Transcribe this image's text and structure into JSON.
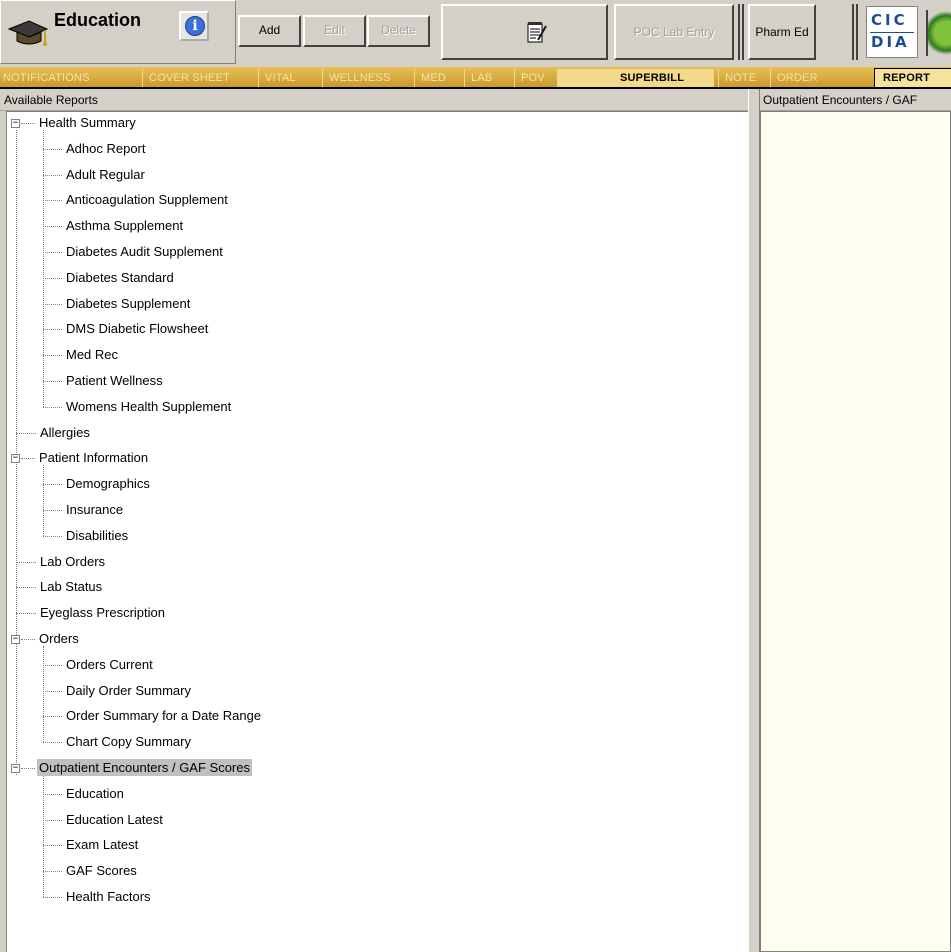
{
  "toolbar": {
    "title": "Education",
    "info_label": "i",
    "add_label": "Add",
    "edit_label": "Edit",
    "delete_label": "Delete",
    "poc_label": "POC Lab Entry",
    "pharm_label": "Pharm Ed",
    "cic_line1": "CIC",
    "cic_line2": "DIA"
  },
  "tabs": [
    {
      "label": "NOTIFICATIONS"
    },
    {
      "label": "COVER SHEET"
    },
    {
      "label": "VITAL"
    },
    {
      "label": "WELLNESS"
    },
    {
      "label": "MED"
    },
    {
      "label": "LAB"
    },
    {
      "label": "POV"
    },
    {
      "label": "SUPERBILL"
    },
    {
      "label": "NOTE"
    },
    {
      "label": "ORDER"
    },
    {
      "label": "REPORT"
    }
  ],
  "left_panel": {
    "header": "Available Reports",
    "tree": [
      {
        "label": "Health Summary",
        "expander": "−"
      },
      {
        "label": "Adhoc Report"
      },
      {
        "label": "Adult Regular"
      },
      {
        "label": "Anticoagulation Supplement"
      },
      {
        "label": "Asthma Supplement"
      },
      {
        "label": "Diabetes Audit Supplement"
      },
      {
        "label": "Diabetes Standard"
      },
      {
        "label": "Diabetes Supplement"
      },
      {
        "label": "DMS Diabetic Flowsheet"
      },
      {
        "label": "Med Rec"
      },
      {
        "label": "Patient Wellness"
      },
      {
        "label": "Womens Health Supplement"
      },
      {
        "label": "Allergies"
      },
      {
        "label": "Patient Information",
        "expander": "−"
      },
      {
        "label": "Demographics"
      },
      {
        "label": "Insurance"
      },
      {
        "label": "Disabilities"
      },
      {
        "label": "Lab Orders"
      },
      {
        "label": "Lab Status"
      },
      {
        "label": "Eyeglass Prescription"
      },
      {
        "label": "Orders",
        "expander": "−"
      },
      {
        "label": "Orders Current"
      },
      {
        "label": "Daily Order Summary"
      },
      {
        "label": "Order Summary for a Date Range"
      },
      {
        "label": "Chart Copy Summary"
      },
      {
        "label": "Outpatient Encounters / GAF Scores",
        "expander": "−"
      },
      {
        "label": "Education"
      },
      {
        "label": "Education Latest"
      },
      {
        "label": "Exam Latest"
      },
      {
        "label": "GAF Scores"
      },
      {
        "label": "Health Factors"
      }
    ]
  },
  "right_panel": {
    "header": "Outpatient Encounters / GAF"
  }
}
